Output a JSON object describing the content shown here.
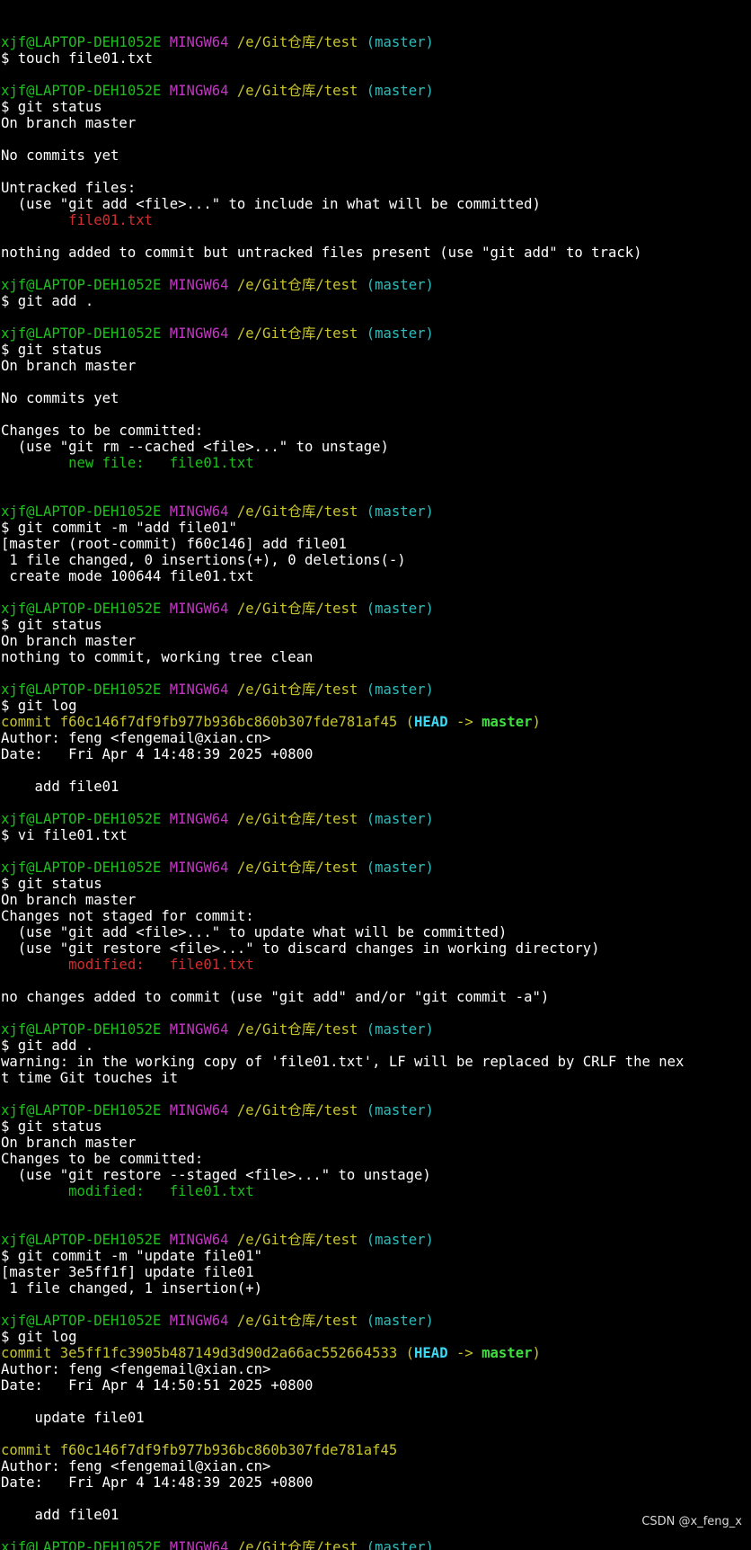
{
  "prompt": {
    "user_host": "xjf@LAPTOP-DEH1052E",
    "env": "MINGW64",
    "path": "/e/Git仓库/test",
    "branch": "(master)",
    "symbol": "$"
  },
  "colors": {
    "background": "#000000",
    "user_host": "#1cc11c",
    "env": "#c138c1",
    "path": "#c7c42d",
    "branch": "#2fbcbc",
    "untracked": "#d12e2e",
    "staged": "#1cc11c",
    "text": "#ffffff"
  },
  "lines": [
    {
      "type": "prompt"
    },
    {
      "type": "cmd",
      "text": "$ touch file01.txt"
    },
    {
      "type": "blank"
    },
    {
      "type": "prompt"
    },
    {
      "type": "cmd",
      "text": "$ git status"
    },
    {
      "type": "out",
      "text": "On branch master"
    },
    {
      "type": "blank"
    },
    {
      "type": "out",
      "text": "No commits yet"
    },
    {
      "type": "blank"
    },
    {
      "type": "out",
      "text": "Untracked files:"
    },
    {
      "type": "out",
      "text": "  (use \"git add <file>...\" to include in what will be committed)"
    },
    {
      "type": "red",
      "text": "        file01.txt"
    },
    {
      "type": "blank"
    },
    {
      "type": "out",
      "text": "nothing added to commit but untracked files present (use \"git add\" to track)"
    },
    {
      "type": "blank"
    },
    {
      "type": "prompt"
    },
    {
      "type": "cmd",
      "text": "$ git add ."
    },
    {
      "type": "blank"
    },
    {
      "type": "prompt"
    },
    {
      "type": "cmd",
      "text": "$ git status"
    },
    {
      "type": "out",
      "text": "On branch master"
    },
    {
      "type": "blank"
    },
    {
      "type": "out",
      "text": "No commits yet"
    },
    {
      "type": "blank"
    },
    {
      "type": "out",
      "text": "Changes to be committed:"
    },
    {
      "type": "out",
      "text": "  (use \"git rm --cached <file>...\" to unstage)"
    },
    {
      "type": "green",
      "text": "        new file:   file01.txt"
    },
    {
      "type": "blank"
    },
    {
      "type": "blank"
    },
    {
      "type": "prompt"
    },
    {
      "type": "cmd",
      "text": "$ git commit -m \"add file01\""
    },
    {
      "type": "out",
      "text": "[master (root-commit) f60c146] add file01"
    },
    {
      "type": "out",
      "text": " 1 file changed, 0 insertions(+), 0 deletions(-)"
    },
    {
      "type": "out",
      "text": " create mode 100644 file01.txt"
    },
    {
      "type": "blank"
    },
    {
      "type": "prompt"
    },
    {
      "type": "cmd",
      "text": "$ git status"
    },
    {
      "type": "out",
      "text": "On branch master"
    },
    {
      "type": "out",
      "text": "nothing to commit, working tree clean"
    },
    {
      "type": "blank"
    },
    {
      "type": "prompt"
    },
    {
      "type": "cmd",
      "text": "$ git log"
    },
    {
      "type": "commit",
      "text": "commit f60c146f7df9fb977b936bc860b307fde781af45",
      "head": "HEAD",
      "arrow": " -> ",
      "ref": "master"
    },
    {
      "type": "out",
      "text": "Author: feng <fengemail@xian.cn>"
    },
    {
      "type": "out",
      "text": "Date:   Fri Apr 4 14:48:39 2025 +0800"
    },
    {
      "type": "blank"
    },
    {
      "type": "out",
      "text": "    add file01"
    },
    {
      "type": "blank"
    },
    {
      "type": "prompt"
    },
    {
      "type": "cmd",
      "text": "$ vi file01.txt"
    },
    {
      "type": "blank"
    },
    {
      "type": "prompt"
    },
    {
      "type": "cmd",
      "text": "$ git status"
    },
    {
      "type": "out",
      "text": "On branch master"
    },
    {
      "type": "out",
      "text": "Changes not staged for commit:"
    },
    {
      "type": "out",
      "text": "  (use \"git add <file>...\" to update what will be committed)"
    },
    {
      "type": "out",
      "text": "  (use \"git restore <file>...\" to discard changes in working directory)"
    },
    {
      "type": "red",
      "text": "        modified:   file01.txt"
    },
    {
      "type": "blank"
    },
    {
      "type": "out",
      "text": "no changes added to commit (use \"git add\" and/or \"git commit -a\")"
    },
    {
      "type": "blank"
    },
    {
      "type": "prompt"
    },
    {
      "type": "cmd",
      "text": "$ git add ."
    },
    {
      "type": "out",
      "text": "warning: in the working copy of 'file01.txt', LF will be replaced by CRLF the nex"
    },
    {
      "type": "out",
      "text": "t time Git touches it"
    },
    {
      "type": "blank"
    },
    {
      "type": "prompt"
    },
    {
      "type": "cmd",
      "text": "$ git status"
    },
    {
      "type": "out",
      "text": "On branch master"
    },
    {
      "type": "out",
      "text": "Changes to be committed:"
    },
    {
      "type": "out",
      "text": "  (use \"git restore --staged <file>...\" to unstage)"
    },
    {
      "type": "green",
      "text": "        modified:   file01.txt"
    },
    {
      "type": "blank"
    },
    {
      "type": "blank"
    },
    {
      "type": "prompt"
    },
    {
      "type": "cmd",
      "text": "$ git commit -m \"update file01\""
    },
    {
      "type": "out",
      "text": "[master 3e5ff1f] update file01"
    },
    {
      "type": "out",
      "text": " 1 file changed, 1 insertion(+)"
    },
    {
      "type": "blank"
    },
    {
      "type": "prompt"
    },
    {
      "type": "cmd",
      "text": "$ git log"
    },
    {
      "type": "commit",
      "text": "commit 3e5ff1fc3905b487149d3d90d2a66ac552664533",
      "head": "HEAD",
      "arrow": " -> ",
      "ref": "master"
    },
    {
      "type": "out",
      "text": "Author: feng <fengemail@xian.cn>"
    },
    {
      "type": "out",
      "text": "Date:   Fri Apr 4 14:50:51 2025 +0800"
    },
    {
      "type": "blank"
    },
    {
      "type": "out",
      "text": "    update file01"
    },
    {
      "type": "blank"
    },
    {
      "type": "commit_plain",
      "text": "commit f60c146f7df9fb977b936bc860b307fde781af45"
    },
    {
      "type": "out",
      "text": "Author: feng <fengemail@xian.cn>"
    },
    {
      "type": "out",
      "text": "Date:   Fri Apr 4 14:48:39 2025 +0800"
    },
    {
      "type": "blank"
    },
    {
      "type": "out",
      "text": "    add file01"
    },
    {
      "type": "blank"
    },
    {
      "type": "prompt"
    },
    {
      "type": "cmd",
      "text": "$"
    }
  ],
  "watermark": "CSDN @x_feng_x"
}
